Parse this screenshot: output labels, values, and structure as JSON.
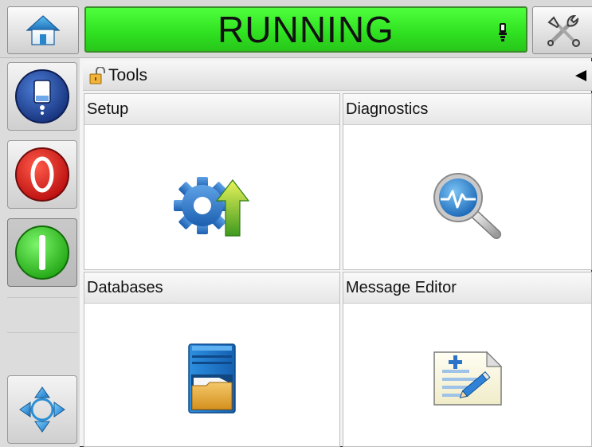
{
  "status": {
    "text": "RUNNING",
    "color": "#33e823"
  },
  "topbar": {
    "home_icon": "home-icon",
    "tools_icon": "tools-icon",
    "lamp_icon": "beacon-lamp-icon"
  },
  "sidebar": {
    "buttons": [
      {
        "icon": "ink-system-icon",
        "color": "#1f4aa0"
      },
      {
        "icon": "stop-icon",
        "color": "#e01e1e"
      },
      {
        "icon": "start-icon",
        "color": "#3ad12a"
      },
      {
        "icon": "navigation-arrows-icon",
        "color": "#2a8fd6"
      }
    ]
  },
  "breadcrumb": {
    "label": "Tools",
    "lock_icon": "unlocked-padlock-icon",
    "back_icon": "back-triangle-icon"
  },
  "tiles": [
    {
      "label": "Setup",
      "icon": "gear-upgrade-icon"
    },
    {
      "label": "Diagnostics",
      "icon": "magnifier-waveform-icon"
    },
    {
      "label": "Databases",
      "icon": "file-cabinet-icon"
    },
    {
      "label": "Message Editor",
      "icon": "document-edit-icon"
    }
  ]
}
